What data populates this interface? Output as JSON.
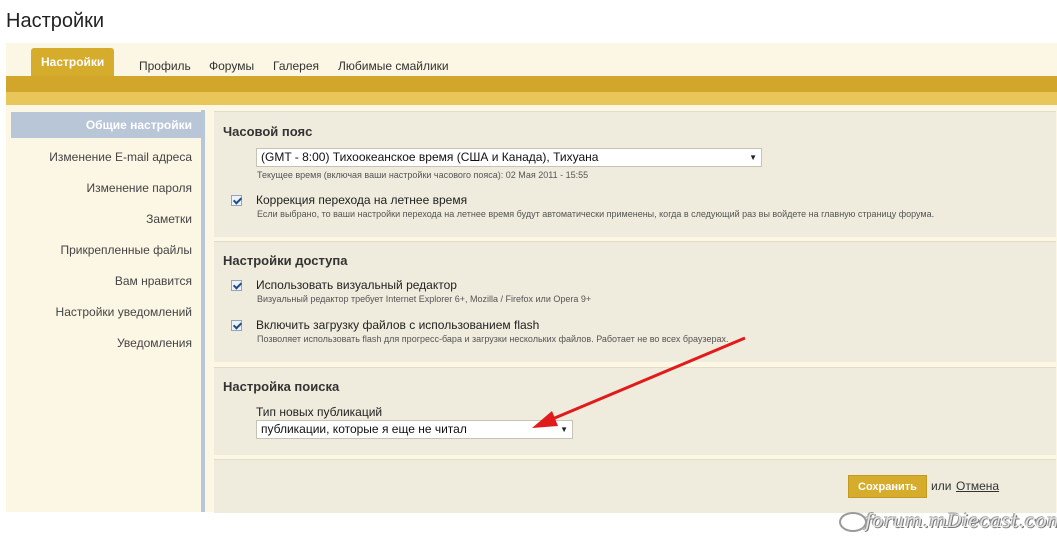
{
  "page": {
    "title": "Настройки"
  },
  "tabs": [
    {
      "label": "Настройки",
      "active": true
    },
    {
      "label": "Профиль"
    },
    {
      "label": "Форумы"
    },
    {
      "label": "Галерея"
    },
    {
      "label": "Любимые смайлики"
    }
  ],
  "sidebar": {
    "items": [
      {
        "label": "Общие настройки",
        "active": true
      },
      {
        "label": "Изменение E-mail адреса"
      },
      {
        "label": "Изменение пароля"
      },
      {
        "label": "Заметки"
      },
      {
        "label": "Прикрепленные файлы"
      },
      {
        "label": "Вам нравится"
      },
      {
        "label": "Настройки уведомлений"
      },
      {
        "label": "Уведомления"
      }
    ]
  },
  "timezone": {
    "title": "Часовой пояс",
    "select_value": "(GMT - 8:00) Тихоокеанское время (США и Канада), Тихуана",
    "current_time_hint": "Текущее время (включая ваши настройки часового пояса): 02 Мая 2011 - 15:55",
    "dst": {
      "label": "Коррекция перехода на летнее время",
      "checked": true,
      "hint": "Если выбрано, то ваши настройки перехода на летнее время будут автоматически применены, когда в следующий раз вы войдете на главную страницу форума."
    }
  },
  "access": {
    "title": "Настройки доступа",
    "visual_editor": {
      "label": "Использовать визуальный редактор",
      "checked": true,
      "hint": "Визуальный редактор требует Internet Explorer 6+, Mozilla / Firefox или Opera 9+"
    },
    "flash_upload": {
      "label": "Включить загрузку файлов с использованием flash",
      "checked": true,
      "hint": "Позволяет использовать flash для прогресс-бара и загрузки нескольких файлов. Работает не во всех браузерах."
    }
  },
  "search": {
    "title": "Настройка поиска",
    "new_posts_label": "Тип новых публикаций",
    "new_posts_value": "публикации, которые я еще не читал"
  },
  "actions": {
    "save_label": "Сохранить",
    "or_text": "или",
    "cancel_label": "Отмена"
  },
  "watermark": "forum.mDiecast.com",
  "colors": {
    "accent": "#d6ac2c",
    "sidebar_active": "#b8c6d8",
    "panel_bg": "#efebdd",
    "page_bg": "#fcf6e4",
    "annotation_arrow": "#e11b1b"
  }
}
